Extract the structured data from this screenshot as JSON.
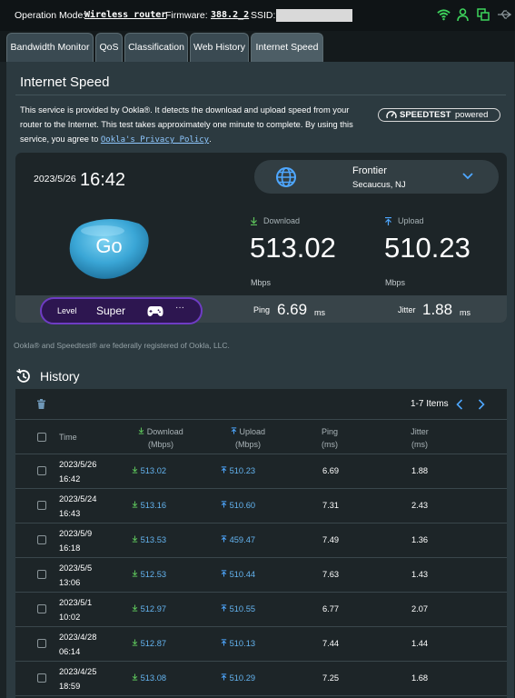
{
  "topbar": {
    "op_mode_label": "Operation Mode:",
    "op_mode_value": "Wireless router",
    "firmware_label": "Firmware:",
    "firmware_value": "388.2_2",
    "ssid_label": "SSID:"
  },
  "tabs": [
    {
      "label": "Bandwidth Monitor"
    },
    {
      "label": "QoS"
    },
    {
      "label": "Classification"
    },
    {
      "label": "Web History"
    },
    {
      "label": "Internet Speed"
    }
  ],
  "section": {
    "title": "Internet Speed",
    "desc_main": "This service is provided by Ookla®. It detects the download and upload speed from your router to the Internet. This test takes approximately one minute to complete. By using this service, you agree to ",
    "desc_link": "Ookla's Privacy Policy",
    "desc_end": ".",
    "badge_speedtest": "SPEEDTEST",
    "badge_powered": "powered"
  },
  "test": {
    "date": "2023/5/26",
    "time": "16:42",
    "server_name": "Frontier",
    "server_location": "Secaucus, NJ",
    "go_label": "Go",
    "download_label": "Download",
    "download_value": "513.02",
    "download_unit": "Mbps",
    "upload_label": "Upload",
    "upload_value": "510.23",
    "upload_unit": "Mbps",
    "level_label": "Level",
    "level_value": "Super",
    "level_more": "···",
    "ping_label": "Ping",
    "ping_value": "6.69",
    "ping_unit": "ms",
    "jitter_label": "Jitter",
    "jitter_value": "1.88",
    "jitter_unit": "ms"
  },
  "footnote": "Ookla® and Speedtest® are federally registered of Ookla, LLC.",
  "history": {
    "title": "History",
    "items_count": "1-7 Items",
    "columns": {
      "time": "Time",
      "download": "Download",
      "download_unit": "(Mbps)",
      "upload": "Upload",
      "upload_unit": "(Mbps)",
      "ping": "Ping",
      "ping_unit": "(ms)",
      "jitter": "Jitter",
      "jitter_unit": "(ms)"
    },
    "rows": [
      {
        "date": "2023/5/26",
        "time": "16:42",
        "download": "513.02",
        "upload": "510.23",
        "ping": "6.69",
        "jitter": "1.88"
      },
      {
        "date": "2023/5/24",
        "time": "16:43",
        "download": "513.16",
        "upload": "510.60",
        "ping": "7.31",
        "jitter": "2.43"
      },
      {
        "date": "2023/5/9",
        "time": "16:18",
        "download": "513.53",
        "upload": "459.47",
        "ping": "7.49",
        "jitter": "1.36"
      },
      {
        "date": "2023/5/5",
        "time": "13:06",
        "download": "512.53",
        "upload": "510.44",
        "ping": "7.63",
        "jitter": "1.43"
      },
      {
        "date": "2023/5/1",
        "time": "10:02",
        "download": "512.97",
        "upload": "510.55",
        "ping": "6.77",
        "jitter": "2.07"
      },
      {
        "date": "2023/4/28",
        "time": "06:14",
        "download": "512.87",
        "upload": "510.13",
        "ping": "7.44",
        "jitter": "1.44"
      },
      {
        "date": "2023/4/25",
        "time": "18:59",
        "download": "513.08",
        "upload": "510.29",
        "ping": "7.25",
        "jitter": "1.68"
      }
    ]
  },
  "icons": {
    "wifi": "wifi-icon",
    "user": "user-icon",
    "copy": "copy-icon",
    "usb": "usb-icon",
    "globe": "globe-icon",
    "chevron": "chevron-down-icon",
    "trash": "trash-icon",
    "history": "history-icon",
    "gamepad": "gamepad-icon"
  },
  "colors": {
    "accent": "#64b4f0",
    "status_green": "#3dd35c",
    "level_purple": "#6e3cc4"
  }
}
